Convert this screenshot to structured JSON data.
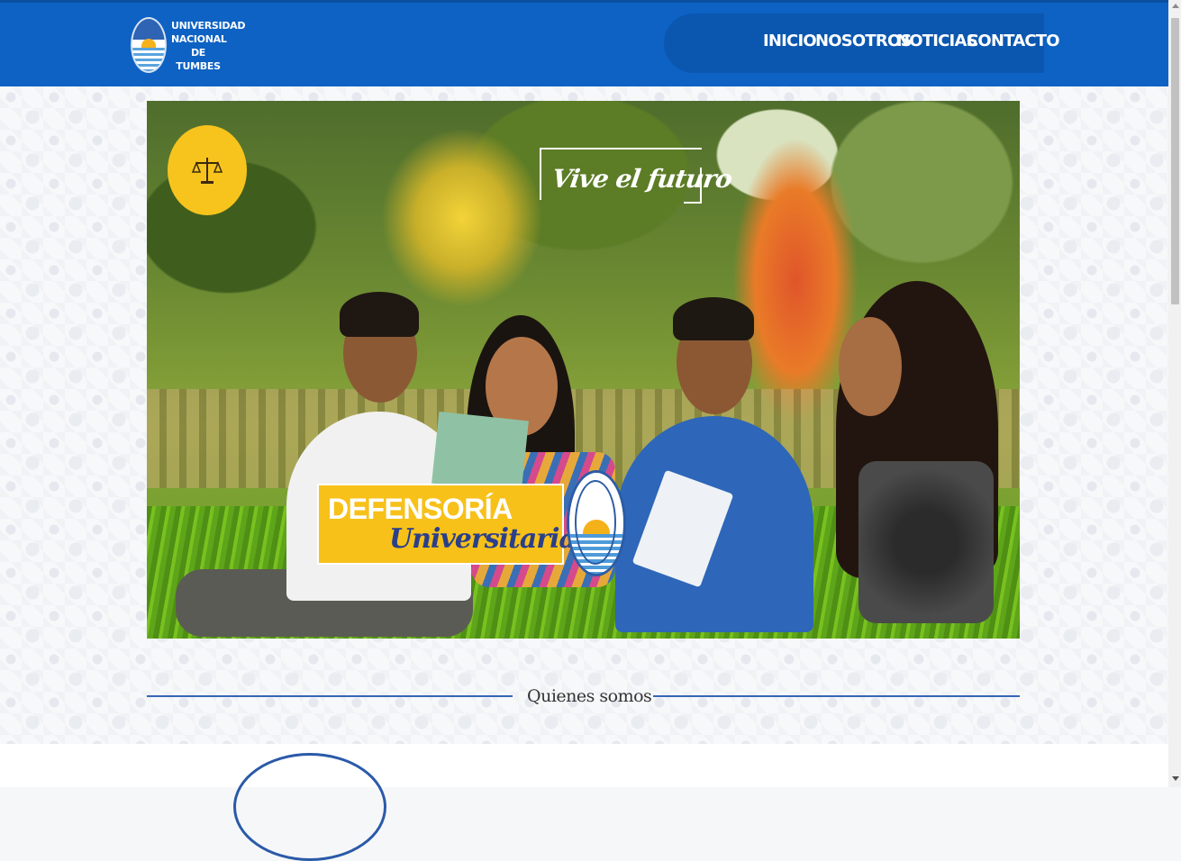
{
  "header": {
    "logo_text": [
      "UNIVERSIDAD",
      "NACIONAL",
      "DE TUMBES"
    ],
    "nav": [
      {
        "label": "INICIO"
      },
      {
        "label": "NOSOTROS"
      },
      {
        "label": "NOTICIAS"
      },
      {
        "label": "CONTACTO"
      }
    ]
  },
  "hero": {
    "slogan": "Vive el futuro",
    "banner_title": "DEFENSORÍA",
    "banner_subtitle": "Universitaria",
    "emblem_icon": "scales-of-justice-icon"
  },
  "section": {
    "title": "Quienes somos"
  },
  "colors": {
    "header_bg": "#0d62c4",
    "nav_pill": "#0b57b0",
    "accent_yellow": "#f7c11a",
    "divider": "#3566b5"
  }
}
